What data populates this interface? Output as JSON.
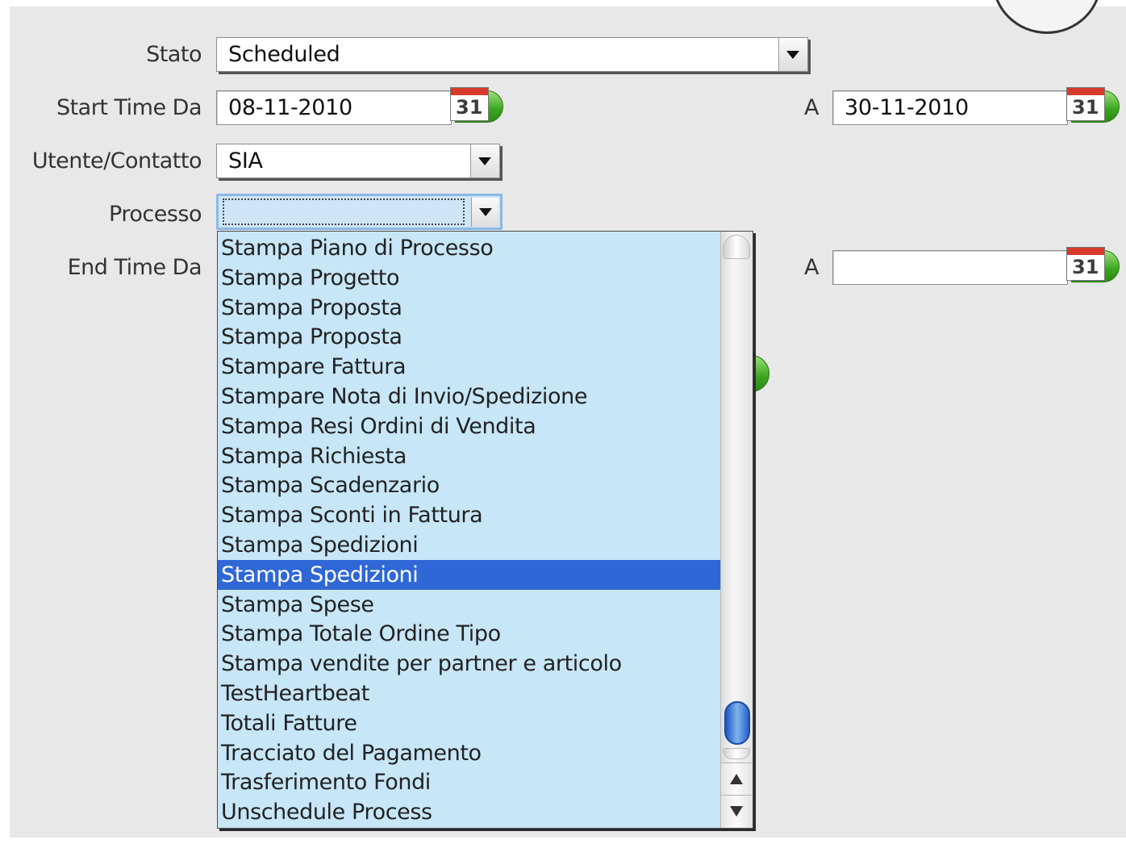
{
  "form": {
    "stato": {
      "label": "Stato",
      "value": "Scheduled"
    },
    "start_time": {
      "label": "Start Time Da",
      "from": "08-11-2010",
      "to_label": "A",
      "to": "30-11-2010"
    },
    "utente": {
      "label": "Utente/Contatto",
      "value": "SIA"
    },
    "processo": {
      "label": "Processo",
      "value": ""
    },
    "end_time": {
      "label": "End Time Da",
      "from": "",
      "to_label": "A",
      "to": ""
    },
    "calendar_day": "31"
  },
  "dropdown": {
    "items": [
      "Stampa Piano di Processo",
      "Stampa Progetto",
      "Stampa Proposta",
      "Stampa Proposta",
      "Stampare Fattura",
      "Stampare Nota di Invio/Spedizione",
      "Stampa Resi Ordini di Vendita",
      "Stampa Richiesta",
      "Stampa Scadenzario",
      "Stampa Sconti in Fattura",
      "Stampa Spedizioni",
      "Stampa Spedizioni",
      "Stampa Spese",
      "Stampa Totale Ordine Tipo",
      "Stampa vendite per partner e articolo",
      "TestHeartbeat",
      "Totali Fatture",
      "Tracciato del Pagamento",
      "Trasferimento Fondi",
      "Unschedule Process"
    ],
    "selected_index": 11
  },
  "icons": {
    "calendar": "calendar-icon",
    "dropdown_arrow": "chevron-down-icon",
    "scroll_up": "arrow-up-icon",
    "scroll_down": "arrow-down-icon"
  },
  "colors": {
    "panel_bg": "#e8e8e8",
    "dropdown_bg": "#c7e6f7",
    "selection": "#2f68d6"
  }
}
